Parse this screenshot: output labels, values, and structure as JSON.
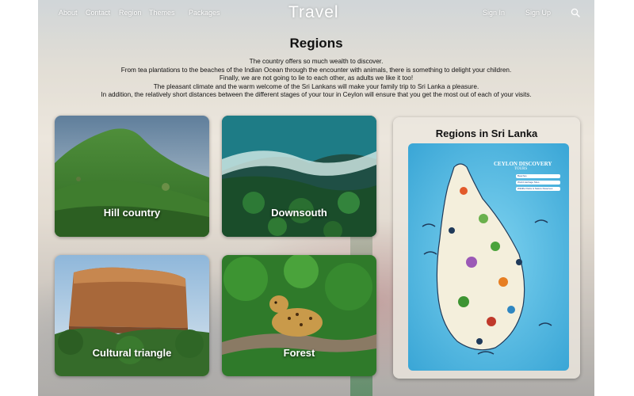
{
  "nav": {
    "links": [
      "About",
      "Contact",
      "Region",
      "Themes",
      "Packages"
    ],
    "brand": "Travel",
    "sign_in": "Sign In",
    "sign_up": "Sign Up"
  },
  "page": {
    "title": "Regions",
    "intro": [
      "The country offers so much wealth to discover.",
      "From tea plantations to the beaches of the Indian Ocean through the encounter with animals, there is something to delight your children.",
      "Finally, we are not going to lie to each other, as adults we like it too!",
      "The pleasant climate and the warm welcome of the Sri Lankans will make your family trip to Sri Lanka a pleasure.",
      "In addition, the relatively short distances between the different stages of your tour in Ceylon will ensure that you get the most out of each of your visits."
    ]
  },
  "regions": [
    {
      "label": "Hill country"
    },
    {
      "label": "Downsouth"
    },
    {
      "label": "Cultural triangle"
    },
    {
      "label": "Forest"
    }
  ],
  "map_panel": {
    "title": "Regions in Sri Lanka",
    "brand": "CEYLON DISCOVERY",
    "sub": "TOURS",
    "legend": [
      "Beaches",
      "World Heritage Sites",
      "Wildlife Parks & Nature Reserves"
    ]
  },
  "colors": {
    "nav_text": "#ffffff",
    "title_text": "#111111",
    "ocean": "#5fc0e6",
    "island": "#f4efdc"
  },
  "icons": {
    "search": "search-icon"
  }
}
